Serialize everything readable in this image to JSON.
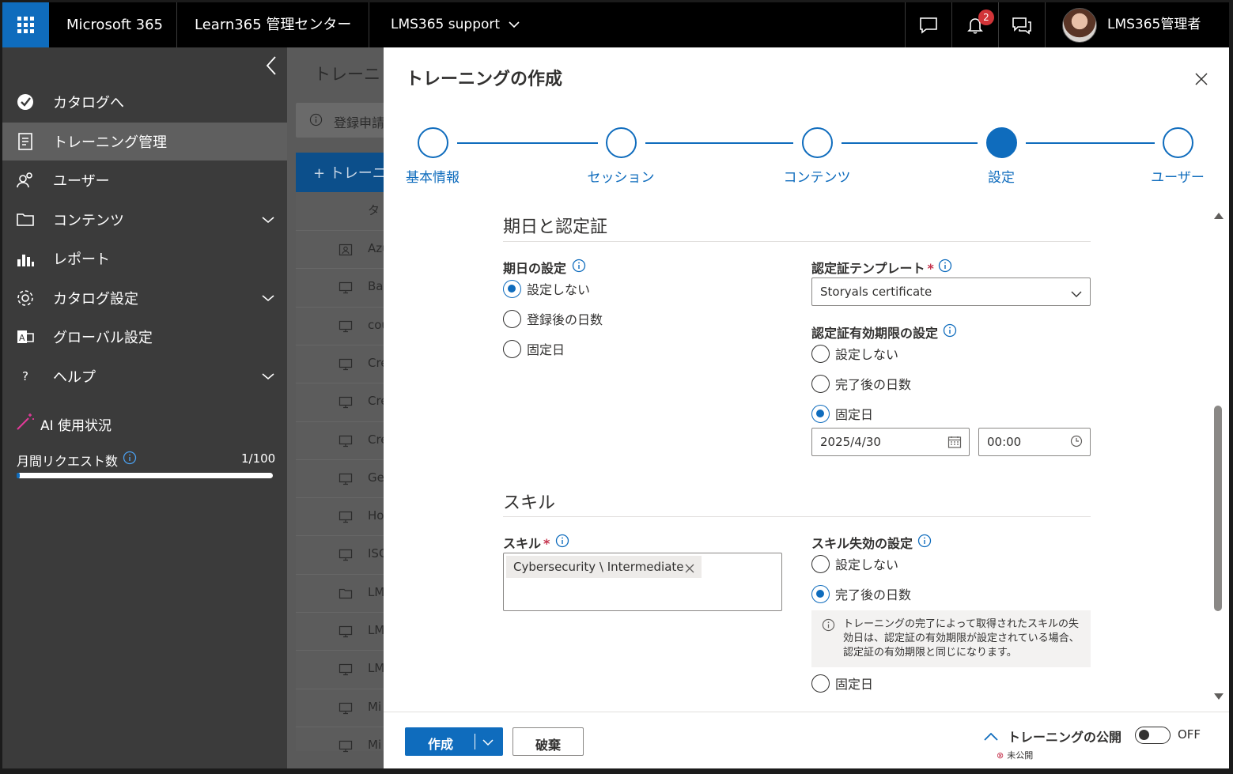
{
  "topbar": {
    "app_name": "Microsoft 365",
    "admin_center": "Learn365 管理センター",
    "tenant": "LMS365 support",
    "notification_count": "2",
    "user_name": "LMS365管理者"
  },
  "sidebar": {
    "items": [
      {
        "label": "カタログへ",
        "icon": "catalog-check-icon"
      },
      {
        "label": "トレーニング管理",
        "icon": "clipboard-icon",
        "active": true
      },
      {
        "label": "ユーザー",
        "icon": "users-icon"
      },
      {
        "label": "コンテンツ",
        "icon": "folder-icon",
        "expandable": true
      },
      {
        "label": "レポート",
        "icon": "bar-chart-icon"
      },
      {
        "label": "カタログ設定",
        "icon": "gear-icon",
        "expandable": true
      },
      {
        "label": "グローバル設定",
        "icon": "language-icon"
      },
      {
        "label": "ヘルプ",
        "icon": "question-icon",
        "expandable": true
      }
    ],
    "ai": {
      "title": "AI 使用状況",
      "requests_label": "月間リクエスト数",
      "requests_value": "1/100",
      "requests_fraction": 0.01
    }
  },
  "background": {
    "page_title": "トレーニ",
    "message": "登録申請",
    "new_button": "+ トレーニ",
    "column_header": "タ",
    "rows": [
      {
        "text": "Azu",
        "icon": "contact-card-icon"
      },
      {
        "text": "Bar",
        "icon": "monitor-icon"
      },
      {
        "text": "cou",
        "icon": "monitor-icon"
      },
      {
        "text": "Cre",
        "icon": "monitor-icon"
      },
      {
        "text": "Cre",
        "icon": "monitor-icon"
      },
      {
        "text": "Cre",
        "icon": "monitor-icon"
      },
      {
        "text": "Ge",
        "icon": "monitor-icon"
      },
      {
        "text": "Ho",
        "icon": "monitor-icon"
      },
      {
        "text": "ISC",
        "icon": "monitor-icon"
      },
      {
        "text": "LM",
        "icon": "folder-icon"
      },
      {
        "text": "LM",
        "icon": "monitor-icon"
      },
      {
        "text": "LM",
        "icon": "monitor-icon"
      },
      {
        "text": "Mi",
        "icon": "monitor-icon"
      },
      {
        "text": "Mi",
        "icon": "monitor-icon"
      }
    ]
  },
  "panel": {
    "title": "トレーニングの作成",
    "steps": [
      {
        "label": "基本情報",
        "state": "done"
      },
      {
        "label": "セッション",
        "state": "done"
      },
      {
        "label": "コンテンツ",
        "state": "done"
      },
      {
        "label": "設定",
        "state": "current"
      },
      {
        "label": "ユーザー",
        "state": "todo"
      }
    ],
    "due": {
      "section_title": "期日と認定証",
      "due_label": "期日の設定",
      "due_options": [
        "設定しない",
        "登録後の日数",
        "固定日"
      ],
      "due_selected": 0,
      "cert_template_label": "認定証テンプレート",
      "cert_template_value": "Storyals certificate",
      "cert_expiry_label": "認定証有効期限の設定",
      "cert_expiry_options": [
        "設定しない",
        "完了後の日数",
        "固定日"
      ],
      "cert_expiry_selected": 2,
      "cert_date": "2025/4/30",
      "cert_time": "00:00"
    },
    "skills": {
      "section_title": "スキル",
      "skill_label": "スキル",
      "skill_chip": "Cybersecurity \\ Intermediate",
      "expiry_label": "スキル失効の設定",
      "expiry_options": [
        "設定しない",
        "完了後の日数",
        "固定日"
      ],
      "expiry_selected": 1,
      "info_text": "トレーニングの完了によって取得されたスキルの失効日は、認定証の有効期限が設定されている場合、認定証の有効期限と同じになります。"
    },
    "footer": {
      "create_label": "作成",
      "discard_label": "破棄",
      "publish_label": "トレーニングの公開",
      "publish_status": "未公開",
      "toggle_state": "OFF"
    }
  },
  "colors": {
    "accent": "#0f6cbd",
    "topbar": "#000000",
    "sidebar": "#3b3b3b",
    "required": "#c4314b"
  }
}
